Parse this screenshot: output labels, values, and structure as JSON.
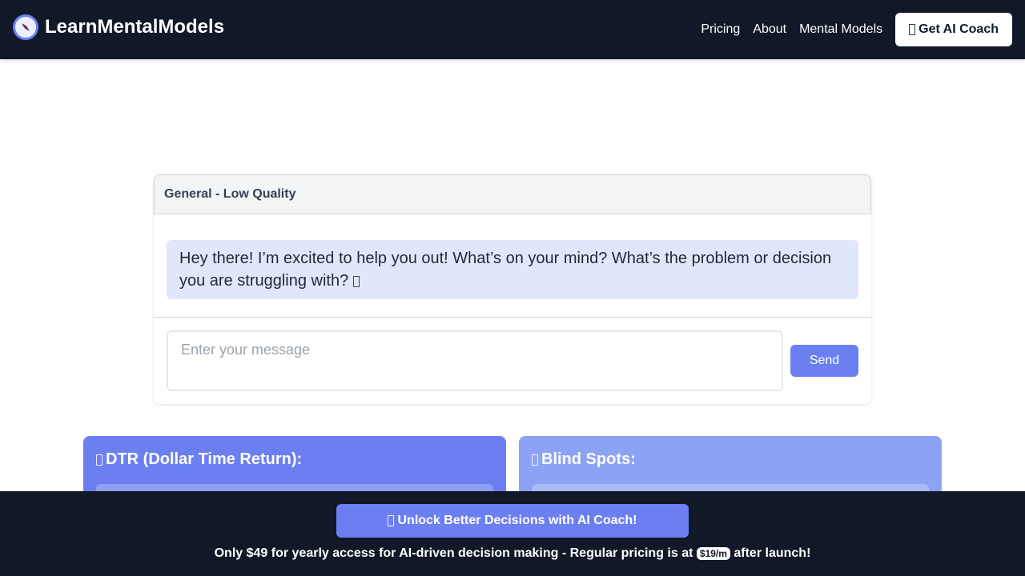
{
  "header": {
    "brand": "LearnMentalModels",
    "logo_icon": "compass-icon",
    "nav": [
      {
        "label": "Pricing"
      },
      {
        "label": "About"
      },
      {
        "label": "Mental Models"
      }
    ],
    "cta_label": "Get AI Coach"
  },
  "chat": {
    "title": "General - Low Quality",
    "messages": [
      {
        "role": "assistant",
        "text": "Hey there! I’m excited to help you out! What’s on your mind? What’s the problem or decision you are struggling with?"
      }
    ],
    "input_placeholder": "Enter your message",
    "input_value": "",
    "send_label": "Send"
  },
  "cards": [
    {
      "title": "DTR (Dollar Time Return):"
    },
    {
      "title": "Blind Spots:"
    }
  ],
  "banner": {
    "button_label": "Unlock Better Decisions with AI Coach!",
    "promo_text": "Only $49 for yearly access for AI-driven decision making - Regular pricing is at",
    "price_badge": "$19/m",
    "promo_suffix": "after launch!"
  },
  "colors": {
    "header_bg": "#111827",
    "accent": "#6b7ff0",
    "accent_light": "#8ca3f5",
    "message_bg": "#e0e7fa"
  }
}
